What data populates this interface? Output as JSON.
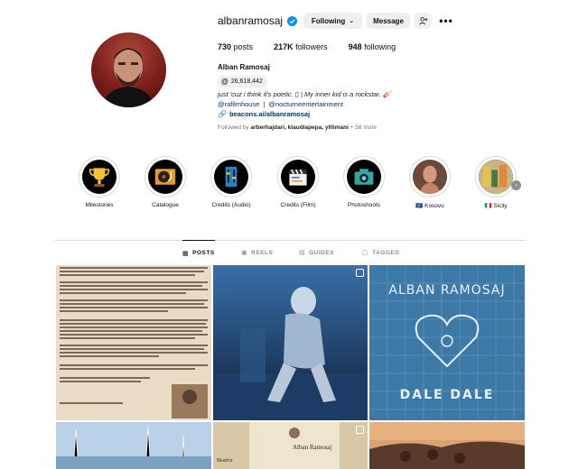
{
  "profile": {
    "username": "albanramosaj",
    "full_name": "Alban Ramosaj",
    "verified": true,
    "threads_count": "26,618,442",
    "bio": "just 'cuz i think it's poetic. ▯ | My inner kid is a rockstar. 🎸",
    "mention_1": "@rafilmhouse",
    "mention_sep": "|",
    "mention_2": "@nocturneentertainment",
    "website": "beacons.ai/albanramosaj",
    "followed_by_prefix": "Followed by",
    "followed_by_names": "arberhajdari, klaudiapepa, ylllimani",
    "followed_by_suffix": "+ 58 more"
  },
  "actions": {
    "following_label": "Following",
    "message_label": "Message",
    "more_icon": "more-horizontal-icon",
    "add_user_icon": "add-user-icon"
  },
  "stats": {
    "posts_value": "730",
    "posts_label": "posts",
    "followers_value": "217K",
    "followers_label": "followers",
    "following_value": "948",
    "following_label": "following"
  },
  "highlights": [
    {
      "label": "Milestones",
      "icon": "trophy-icon"
    },
    {
      "label": "Catalogue",
      "icon": "turntable-icon"
    },
    {
      "label": "Credits (Audio)",
      "icon": "mixer-icon"
    },
    {
      "label": "Credits (Film)",
      "icon": "clapperboard-icon"
    },
    {
      "label": "Photoshoots",
      "icon": "camera-icon"
    },
    {
      "label": "🇽🇰 Kosovo",
      "icon": "photo-thumbnail"
    },
    {
      "label": "🇮🇹 Sicily",
      "icon": "photo-thumbnail"
    }
  ],
  "tabs": [
    {
      "label": "POSTS",
      "icon": "grid-icon",
      "active": true
    },
    {
      "label": "REELS",
      "icon": "reels-icon",
      "active": false
    },
    {
      "label": "GUIDES",
      "icon": "guides-icon",
      "active": false
    },
    {
      "label": "TAGGED",
      "icon": "tagged-icon",
      "active": false
    }
  ],
  "posts": [
    {
      "kind": "text-document",
      "reel": false
    },
    {
      "kind": "robot-render",
      "reel": true
    },
    {
      "kind": "blueprint",
      "title_top": "ALBAN RAMOSAJ",
      "title_bottom": "DALE DALE",
      "reel": false
    },
    {
      "kind": "harbour-photo",
      "reel": false
    },
    {
      "kind": "book-cover",
      "author": "Alban Ramosaj",
      "side_label": "Beatrix",
      "reel": true
    },
    {
      "kind": "sunset-group-photo",
      "reel": false
    }
  ],
  "colors": {
    "link": "#00376b",
    "button_bg": "#efefef",
    "verified": "#0095f6",
    "muted": "#737373",
    "blueprint": "#3d79a7"
  }
}
